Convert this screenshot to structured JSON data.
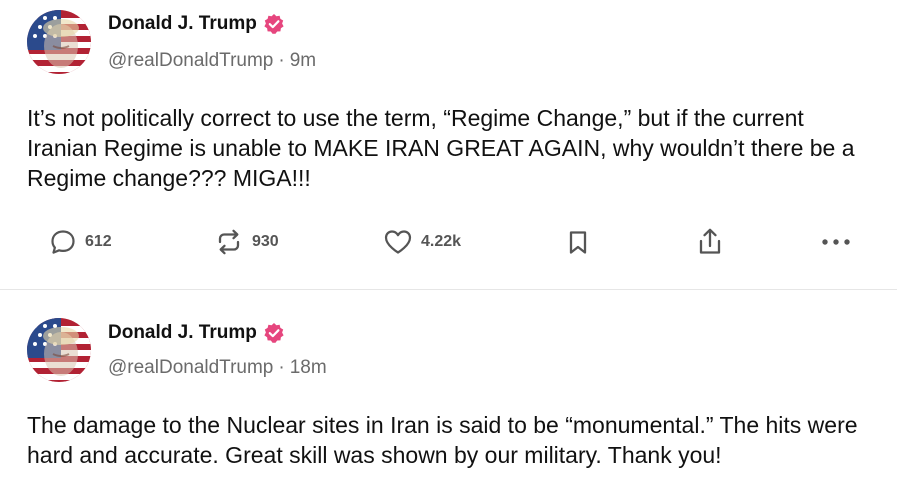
{
  "colors": {
    "verified_badge": "#e6467e",
    "text_primary": "#111111",
    "text_secondary": "#6b6b6b",
    "icon": "#555555",
    "divider": "#e6e6e6"
  },
  "posts": [
    {
      "author": {
        "display_name": "Donald J. Trump",
        "handle": "@realDonaldTrump",
        "verified_icon": "verified-badge-icon",
        "avatar_icon": "avatar-image"
      },
      "time_separator": "·",
      "time": "9m",
      "text": "It’s not politically correct to use the term, “Regime Change,” but if the current Iranian Regime is unable to MAKE IRAN GREAT AGAIN, why wouldn’t there be a Regime change??? MIGA!!!",
      "actions": {
        "replies": "612",
        "reposts": "930",
        "likes": "4.22k",
        "reply_icon": "reply-icon",
        "repost_icon": "repost-icon",
        "like_icon": "heart-icon",
        "bookmark_icon": "bookmark-icon",
        "share_icon": "share-icon",
        "more_icon": "more-icon"
      }
    },
    {
      "author": {
        "display_name": "Donald J. Trump",
        "handle": "@realDonaldTrump",
        "verified_icon": "verified-badge-icon",
        "avatar_icon": "avatar-image"
      },
      "time_separator": "·",
      "time": "18m",
      "text": "The damage to the Nuclear sites in Iran is said to be “monumental.” The hits were hard and accurate. Great skill was shown by our military. Thank you!"
    }
  ]
}
